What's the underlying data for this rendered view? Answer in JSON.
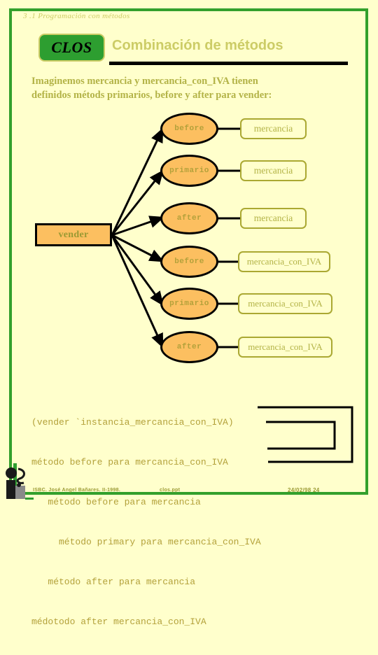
{
  "slide": {
    "eyebrow": "3 .1 Programación con métodos",
    "logo_badge": "CLOS",
    "title": "Combinación de métodos",
    "intro_lines": [
      "Imaginemos mercancia y mercancia_con_IVA tienen",
      "definidos métods primarios, before y after para vender:"
    ],
    "colors": {
      "background": "#ffffcc",
      "frame_green": "#33a02c",
      "badge_green": "#2d9e30",
      "olive_text": "#b3b347",
      "ellipse_fill": "#fcbf60",
      "box_border": "#aaa832",
      "black": "#000000"
    }
  },
  "diagram": {
    "source_node": {
      "label": "vender"
    },
    "rows": [
      {
        "method": "before",
        "class": "mercancia"
      },
      {
        "method": "primario",
        "class": "mercancia"
      },
      {
        "method": "after",
        "class": "mercancia"
      },
      {
        "method": "before",
        "class": "mercancia_con_IVA"
      },
      {
        "method": "primario",
        "class": "mercancia_con_IVA"
      },
      {
        "method": "after",
        "class": "mercancia_con_IVA"
      }
    ]
  },
  "trace": {
    "lines": [
      "(vender `instancia_mercancia_con_IVA)",
      "método before para mercancia_con_IVA",
      "   método before para mercancia",
      "     método primary para mercancia_con_IVA",
      "   método after para mercancia",
      "médotodo after mercancia_con_IVA"
    ]
  },
  "footer": {
    "left": "ISBC. José Angel Bañares. II-1998.",
    "middle": "clos.ppt",
    "right": "24/02/98  24"
  }
}
